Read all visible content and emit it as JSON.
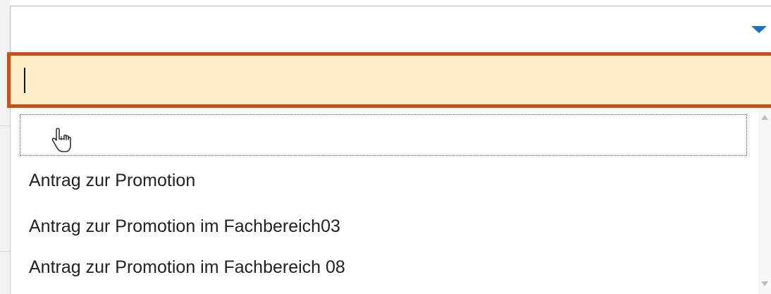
{
  "select": {
    "selected_value": "",
    "chevron_icon": "chevron-down-icon",
    "accent_color": "#1a73c8"
  },
  "search": {
    "value": "",
    "placeholder": "",
    "focus_border_color": "#c6511a",
    "background_color": "#fff0c8"
  },
  "dropdown": {
    "options": [
      {
        "label": ""
      },
      {
        "label": "Antrag zur Promotion"
      },
      {
        "label": "Antrag zur Promotion im Fachbereich03"
      },
      {
        "label": "Antrag zur Promotion im Fachbereich 08"
      }
    ]
  },
  "cursor": {
    "icon": "hand-pointer-icon"
  }
}
